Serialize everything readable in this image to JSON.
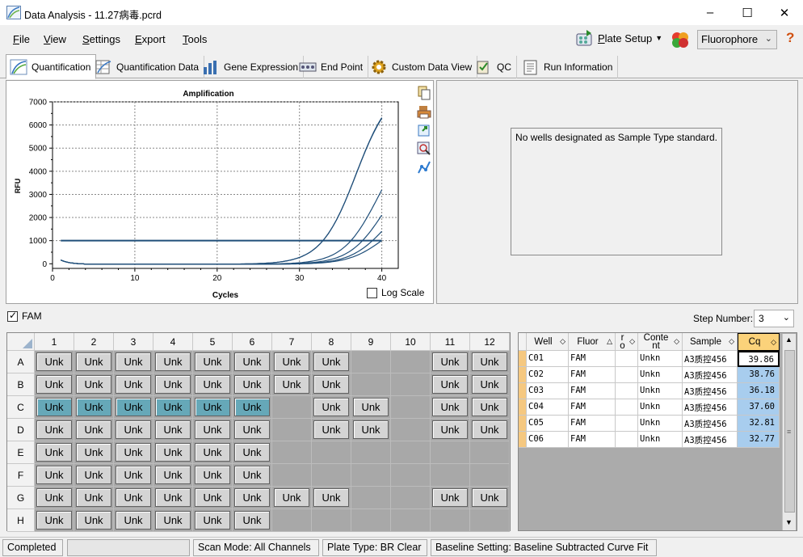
{
  "window": {
    "title": "Data Analysis - 11.27病毒.pcrd"
  },
  "menu": {
    "items": [
      {
        "label": "File",
        "key": "F",
        "rest": "ile"
      },
      {
        "label": "View",
        "key": "V",
        "rest": "iew"
      },
      {
        "label": "Settings",
        "key": "S",
        "rest": "ettings"
      },
      {
        "label": "Export",
        "key": "E",
        "rest": "xport"
      },
      {
        "label": "Tools",
        "key": "T",
        "rest": "ools"
      }
    ],
    "plate_setup": "Plate Setup",
    "plate_setup_key": "P",
    "plate_setup_rest": "late Setup",
    "fluorophore": "Fluorophore"
  },
  "tabs": [
    {
      "label": "Quantification",
      "icon": "amplification-icon"
    },
    {
      "label": "Quantification Data",
      "icon": "data-sheet-icon"
    },
    {
      "label": "Gene Expression",
      "icon": "bar-chart-icon"
    },
    {
      "label": "End Point",
      "icon": "end-point-icon"
    },
    {
      "label": "Custom Data View",
      "icon": "gear-icon"
    },
    {
      "label": "QC",
      "icon": "qc-check-icon"
    },
    {
      "label": "Run Information",
      "icon": "run-info-icon"
    }
  ],
  "chart_data": {
    "type": "line",
    "title": "Amplification",
    "xlabel": "Cycles",
    "ylabel": "RFU",
    "xlim": [
      0,
      42
    ],
    "ylim": [
      -200,
      7000
    ],
    "xticks": [
      0,
      10,
      20,
      30,
      40
    ],
    "yticks": [
      0,
      1000,
      2000,
      3000,
      4000,
      5000,
      6000,
      7000
    ],
    "grid": true,
    "threshold": 1000,
    "line_color": "#1f4e79",
    "series": [
      {
        "ct": 32.8,
        "plateau": 7800
      },
      {
        "ct": 32.8,
        "plateau": 7750
      },
      {
        "ct": 36.2,
        "plateau": 5800
      },
      {
        "ct": 37.6,
        "plateau": 4600
      },
      {
        "ct": 38.8,
        "plateau": 3200
      },
      {
        "ct": 39.9,
        "plateau": 2200
      }
    ]
  },
  "log_scale": "Log Scale",
  "std_message": "No wells designated as Sample Type standard.",
  "fam_label": "FAM",
  "step_number_label": "Step Number:",
  "step_number": "3",
  "plate": {
    "columns": [
      "1",
      "2",
      "3",
      "4",
      "5",
      "6",
      "7",
      "8",
      "9",
      "10",
      "11",
      "12"
    ],
    "rows": [
      {
        "label": "A",
        "wells": [
          "Unk",
          "Unk",
          "Unk",
          "Unk",
          "Unk",
          "Unk",
          "Unk",
          "Unk",
          "",
          "",
          "Unk",
          "Unk"
        ],
        "selected": []
      },
      {
        "label": "B",
        "wells": [
          "Unk",
          "Unk",
          "Unk",
          "Unk",
          "Unk",
          "Unk",
          "Unk",
          "Unk",
          "",
          "",
          "Unk",
          "Unk"
        ],
        "selected": []
      },
      {
        "label": "C",
        "wells": [
          "Unk",
          "Unk",
          "Unk",
          "Unk",
          "Unk",
          "Unk",
          "",
          "Unk",
          "Unk",
          "",
          "Unk",
          "Unk"
        ],
        "selected": [
          0,
          1,
          2,
          3,
          4,
          5
        ]
      },
      {
        "label": "D",
        "wells": [
          "Unk",
          "Unk",
          "Unk",
          "Unk",
          "Unk",
          "Unk",
          "",
          "Unk",
          "Unk",
          "",
          "Unk",
          "Unk"
        ],
        "selected": []
      },
      {
        "label": "E",
        "wells": [
          "Unk",
          "Unk",
          "Unk",
          "Unk",
          "Unk",
          "Unk",
          "",
          "",
          "",
          "",
          "",
          ""
        ],
        "selected": []
      },
      {
        "label": "F",
        "wells": [
          "Unk",
          "Unk",
          "Unk",
          "Unk",
          "Unk",
          "Unk",
          "",
          "",
          "",
          "",
          "",
          ""
        ],
        "selected": []
      },
      {
        "label": "G",
        "wells": [
          "Unk",
          "Unk",
          "Unk",
          "Unk",
          "Unk",
          "Unk",
          "Unk",
          "Unk",
          "",
          "",
          "Unk",
          "Unk"
        ],
        "selected": []
      },
      {
        "label": "H",
        "wells": [
          "Unk",
          "Unk",
          "Unk",
          "Unk",
          "Unk",
          "Unk",
          "",
          "",
          "",
          "",
          "",
          ""
        ],
        "selected": []
      }
    ]
  },
  "well_table": {
    "headers": [
      "Well",
      "Fluor",
      "r\no",
      "Conte\nnt",
      "Sample",
      "Cq"
    ],
    "rows": [
      {
        "well": "C01",
        "fluor": "FAM",
        "target": "",
        "content": "Unkn",
        "sample": "A3质控456",
        "cq": "39.86"
      },
      {
        "well": "C02",
        "fluor": "FAM",
        "target": "",
        "content": "Unkn",
        "sample": "A3质控456",
        "cq": "38.76"
      },
      {
        "well": "C03",
        "fluor": "FAM",
        "target": "",
        "content": "Unkn",
        "sample": "A3质控456",
        "cq": "36.18"
      },
      {
        "well": "C04",
        "fluor": "FAM",
        "target": "",
        "content": "Unkn",
        "sample": "A3质控456",
        "cq": "37.60"
      },
      {
        "well": "C05",
        "fluor": "FAM",
        "target": "",
        "content": "Unkn",
        "sample": "A3质控456",
        "cq": "32.81"
      },
      {
        "well": "C06",
        "fluor": "FAM",
        "target": "",
        "content": "Unkn",
        "sample": "A3质控456",
        "cq": "32.77"
      }
    ]
  },
  "status": {
    "state": "Completed",
    "scan_mode": "Scan Mode: All Channels",
    "plate_type": "Plate Type: BR Clear",
    "baseline": "Baseline Setting: Baseline Subtracted Curve Fit"
  }
}
